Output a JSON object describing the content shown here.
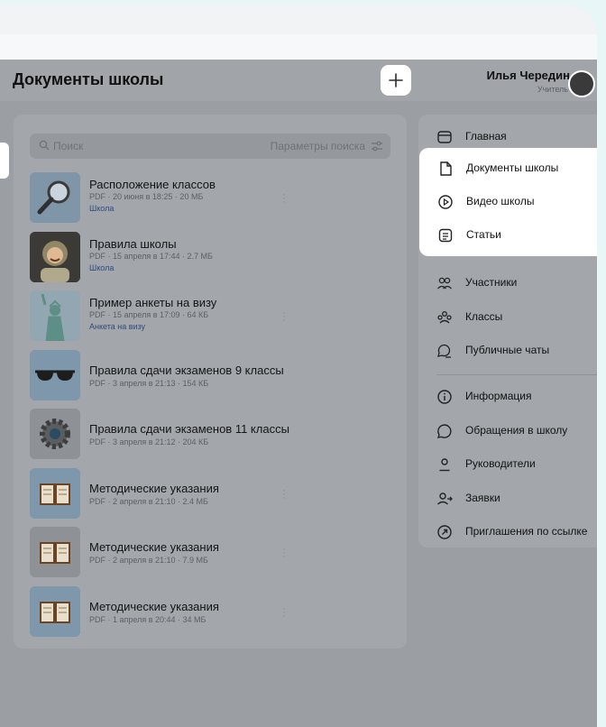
{
  "header": {
    "title": "Документы школы",
    "user_name": "Илья Чередин",
    "user_role": "Учитель"
  },
  "search": {
    "placeholder": "Поиск",
    "params_label": "Параметры поиска"
  },
  "documents": [
    {
      "title": "Расположение классов",
      "meta": "PDF · 20 июня в 18:25 · 20 МБ",
      "tag": "Школа",
      "thumb": "magnifier"
    },
    {
      "title": "Правила школы",
      "meta": "PDF · 15 апреля в 17:44 · 2.7 МБ",
      "tag": "Школа",
      "thumb": "astronaut"
    },
    {
      "title": "Пример анкеты на визу",
      "meta": "PDF · 15 апреля в 17:09 · 64 КБ",
      "tag": "Анкета на визу",
      "thumb": "statue-of-liberty"
    },
    {
      "title": "Правила сдачи экзаменов 9 классы",
      "meta": "PDF · 3 апреля в 21:13 · 154 КБ",
      "tag": "",
      "thumb": "sunglasses"
    },
    {
      "title": "Правила сдачи экзаменов 11 классы",
      "meta": "PDF · 3 апреля в 21:12 · 204 КБ",
      "tag": "",
      "thumb": "gear"
    },
    {
      "title": "Методические указания",
      "meta": "PDF · 2 апреля в 21:10 · 2.4 МБ",
      "tag": "",
      "thumb": "book"
    },
    {
      "title": "Методические указания",
      "meta": "PDF · 2 апреля в 21:10 · 7.9 МБ",
      "tag": "",
      "thumb": "book"
    },
    {
      "title": "Методические указания",
      "meta": "PDF · 1 апреля в 20:44 · 34 МБ",
      "tag": "",
      "thumb": "book"
    }
  ],
  "menu": {
    "group1": [
      {
        "label": "Главная",
        "icon": "home-icon"
      },
      {
        "label": "Документы школы",
        "icon": "document-icon"
      },
      {
        "label": "Видео школы",
        "icon": "video-icon"
      },
      {
        "label": "Статьи",
        "icon": "article-icon"
      }
    ],
    "group2": [
      {
        "label": "Участники",
        "icon": "users-icon"
      },
      {
        "label": "Классы",
        "icon": "classes-icon"
      },
      {
        "label": "Публичные чаты",
        "icon": "chats-icon"
      }
    ],
    "group3": [
      {
        "label": "Информация",
        "icon": "info-icon"
      },
      {
        "label": "Обращения в школу",
        "icon": "message-icon"
      },
      {
        "label": "Руководители",
        "icon": "person-icon"
      },
      {
        "label": "Заявки",
        "icon": "requests-icon"
      },
      {
        "label": "Приглашения по ссылке",
        "icon": "link-icon"
      }
    ]
  }
}
